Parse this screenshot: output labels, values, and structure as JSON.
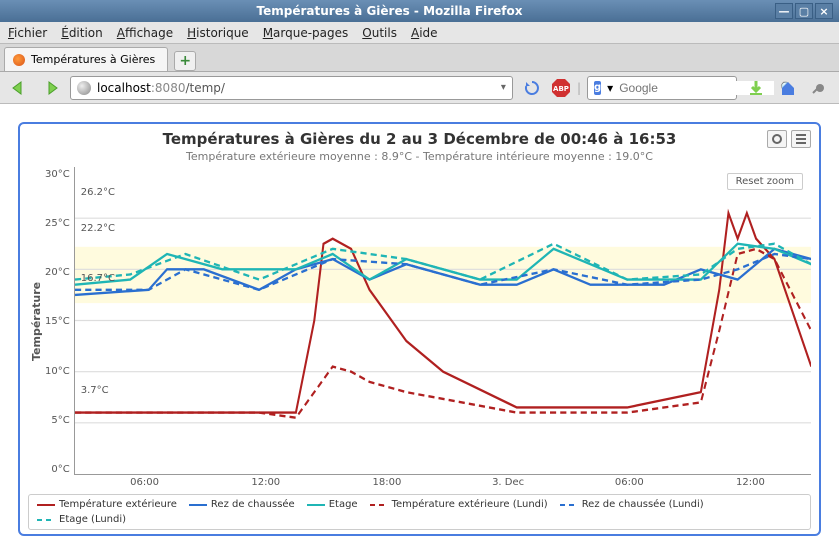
{
  "window": {
    "title": "Températures à Gières - Mozilla Firefox"
  },
  "menu": {
    "file": "Fichier",
    "edit": "Édition",
    "view": "Affichage",
    "history": "Historique",
    "bookmarks": "Marque-pages",
    "tools": "Outils",
    "help": "Aide"
  },
  "tab": {
    "label": "Températures à Gières"
  },
  "url": {
    "host": "localhost",
    "port": ":8080",
    "path": "/temp/"
  },
  "search": {
    "engine_letter": "g",
    "placeholder": "Google"
  },
  "chart_data": {
    "type": "line",
    "title": "Températures à Gières du 2 au 3 Décembre de 00:46 à 16:53",
    "subtitle": "Température extérieure moyenne : 8.9°C - Température intérieure moyenne : 19.0°C",
    "ylabel": "Température",
    "ylim": [
      0,
      30
    ],
    "yticks": [
      "30°C",
      "25°C",
      "20°C",
      "15°C",
      "10°C",
      "5°C",
      "0°C"
    ],
    "xticks": [
      "06:00",
      "12:00",
      "18:00",
      "3. Dec",
      "06:00",
      "12:00"
    ],
    "bands": [
      [
        16.7,
        22.2
      ],
      [
        3.7,
        26.2
      ]
    ],
    "annotations": {
      "a1": "26.2°C",
      "a2": "22.2°C",
      "a3": "16.7°C",
      "a4": "3.7°C",
      "reset": "Reset zoom"
    },
    "series": [
      {
        "name": "Température extérieure",
        "color": "#b02020",
        "dash": false,
        "x": [
          0,
          6,
          10,
          12,
          13,
          13.5,
          14,
          15,
          16,
          18,
          20,
          24,
          30,
          34,
          35,
          35.5,
          36,
          36.5,
          37,
          38,
          40
        ],
        "y": [
          6,
          6,
          6,
          6,
          15,
          22.5,
          23,
          22,
          18,
          13,
          10,
          6.5,
          6.5,
          8,
          18,
          25.5,
          23,
          25.5,
          23,
          21,
          10.5
        ]
      },
      {
        "name": "Rez de chaussée",
        "color": "#2a6fd0",
        "dash": false,
        "x": [
          0,
          4,
          5,
          7,
          10,
          12,
          14,
          16,
          18,
          22,
          24,
          26,
          28,
          32,
          34,
          36,
          38,
          40
        ],
        "y": [
          17.5,
          18,
          20,
          20,
          18,
          20,
          21,
          19,
          20.5,
          18.5,
          18.5,
          20,
          18.5,
          18.5,
          20,
          19,
          22,
          21
        ]
      },
      {
        "name": "Etage",
        "color": "#1fb5b5",
        "dash": false,
        "x": [
          0,
          3,
          5,
          8,
          12,
          14,
          16,
          18,
          22,
          24,
          26,
          30,
          34,
          36,
          38,
          40
        ],
        "y": [
          18.5,
          19,
          21.5,
          20,
          20,
          21.5,
          19,
          21,
          19,
          19,
          22,
          19,
          19,
          22.5,
          22,
          20.5
        ]
      },
      {
        "name": "Température extérieure (Lundi)",
        "color": "#b02020",
        "dash": true,
        "x": [
          0,
          6,
          10,
          12,
          13,
          14,
          15,
          16,
          18,
          24,
          30,
          34,
          35,
          36,
          37,
          38,
          40
        ],
        "y": [
          6,
          6,
          6,
          5.5,
          8,
          10.5,
          10,
          9,
          8,
          6,
          6,
          7,
          14,
          21.5,
          22,
          21,
          14
        ]
      },
      {
        "name": "Rez de chaussée (Lundi)",
        "color": "#2a6fd0",
        "dash": true,
        "x": [
          0,
          4,
          6,
          10,
          14,
          18,
          22,
          26,
          30,
          34,
          36,
          38,
          40
        ],
        "y": [
          18,
          18,
          20,
          18,
          21,
          20.5,
          18.5,
          20,
          18.5,
          19,
          20,
          21.5,
          21
        ]
      },
      {
        "name": "Etage (Lundi)",
        "color": "#1fb5b5",
        "dash": true,
        "x": [
          0,
          3,
          6,
          10,
          14,
          18,
          22,
          26,
          30,
          34,
          36,
          38,
          40
        ],
        "y": [
          19,
          19.5,
          21.5,
          19,
          22,
          21,
          19,
          22.5,
          19,
          19.5,
          22,
          22.5,
          20.5
        ]
      }
    ]
  }
}
